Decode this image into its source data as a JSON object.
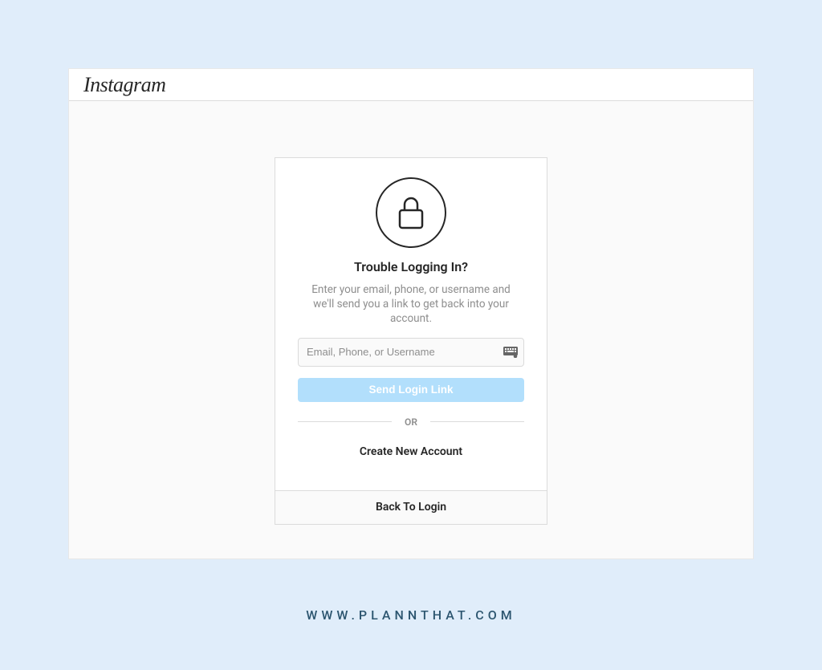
{
  "header": {
    "logo": "Instagram"
  },
  "card": {
    "title": "Trouble Logging In?",
    "description": "Enter your email, phone, or username and we'll send you a link to get back into your account.",
    "input_placeholder": "Email, Phone, or Username",
    "submit_label": "Send Login Link",
    "divider_label": "OR",
    "create_account_label": "Create New Account",
    "back_label": "Back To Login"
  },
  "watermark": "WWW.PLANNTHAT.COM"
}
